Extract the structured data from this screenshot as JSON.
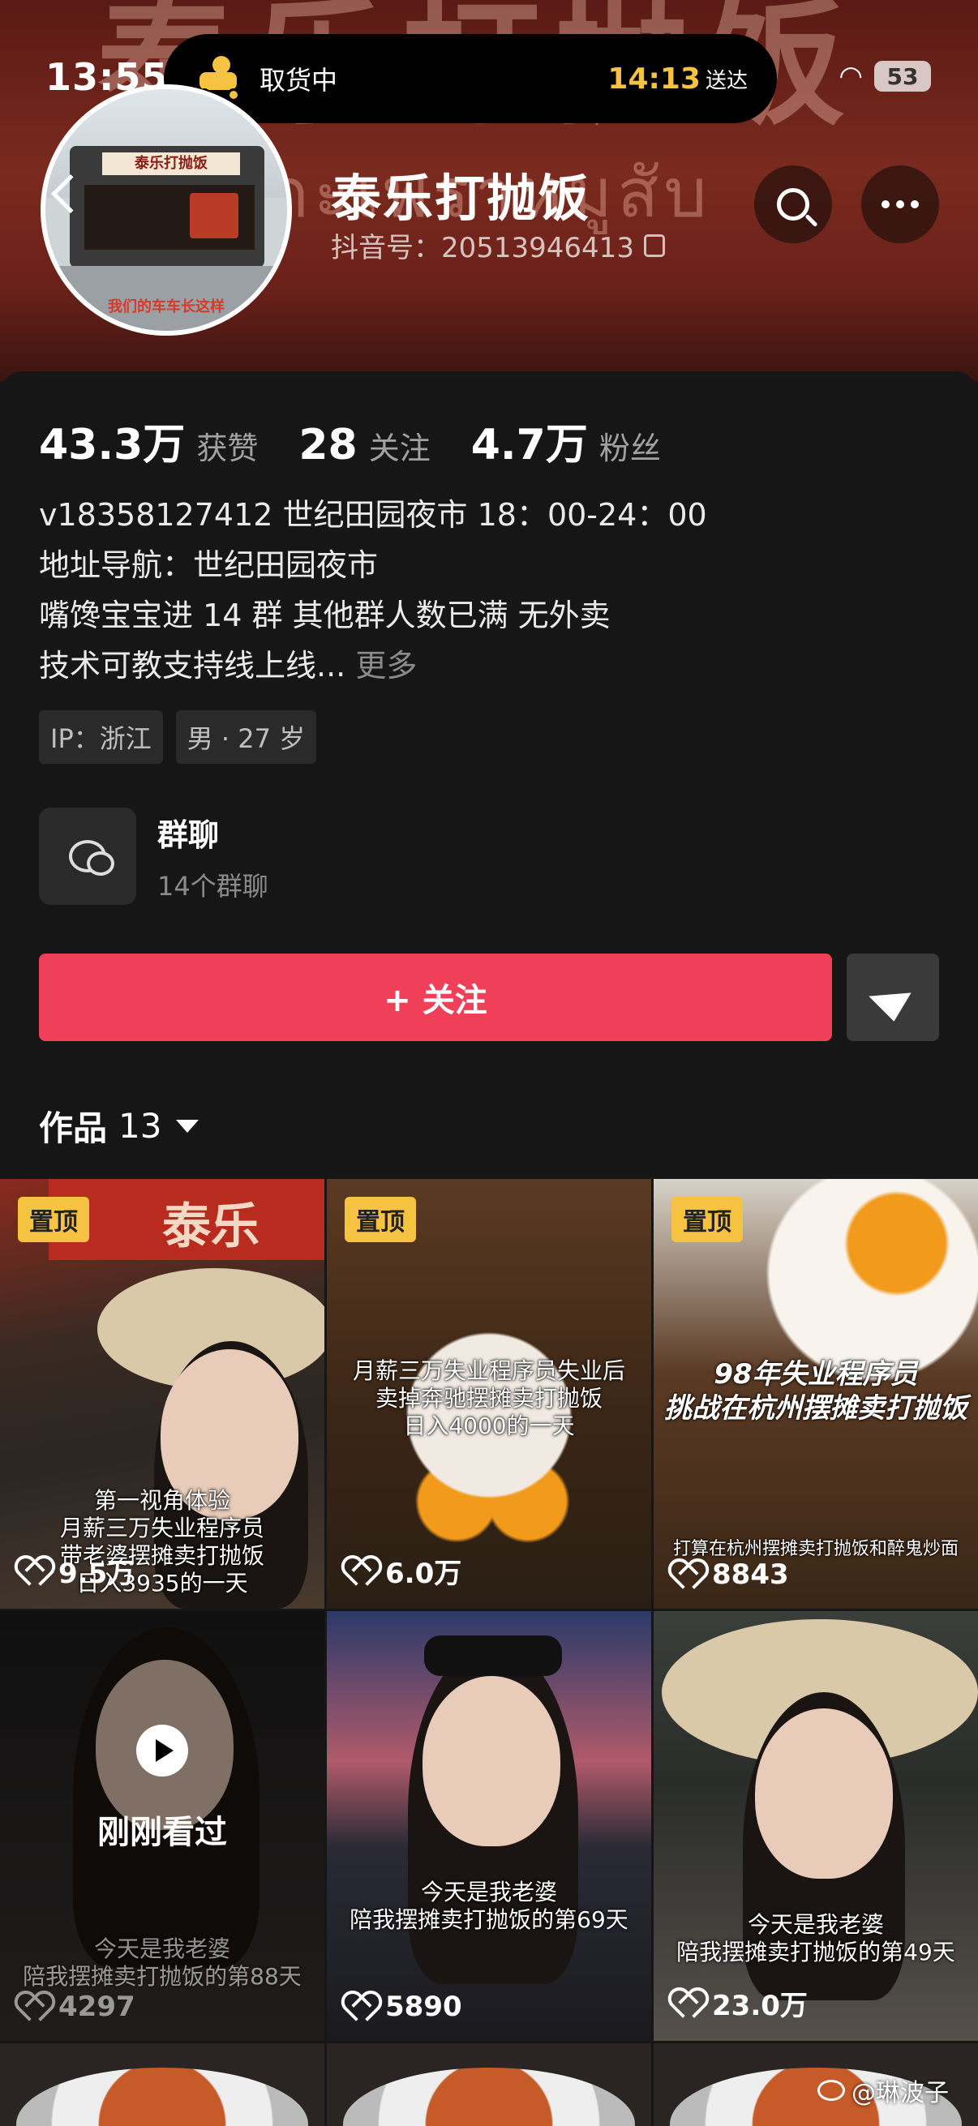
{
  "status": {
    "time": "13:55",
    "battery": "53"
  },
  "live_activity": {
    "label": "取货中",
    "eta_time": "14:13",
    "eta_label": "送达"
  },
  "profile": {
    "name": "泰乐打抛饭",
    "douyin_id": "抖音号：2051394641​3",
    "avatar_caption": "我们的车车长这样",
    "avatar_sign": "泰乐打抛饭",
    "banner_text": "泰乐打抛饭",
    "banner_thai": "กะเพราหมูสับ"
  },
  "stats": [
    {
      "num": "43.3万",
      "label": "获赞"
    },
    {
      "num": "28",
      "label": "关注"
    },
    {
      "num": "4.7万",
      "label": "粉丝"
    }
  ],
  "bio": {
    "line1": "v18358127412  世纪田园夜市 18：00-24：00",
    "line2": "地址导航：世纪田园夜市",
    "line3": "嘴馋宝宝进 14 群 其他群人数已满 无外卖",
    "line4": "技术可教支持线上线...",
    "more": "更多"
  },
  "tags": [
    "IP：浙江",
    "男 · 27 岁"
  ],
  "group": {
    "title": "群聊",
    "subtitle": "14个群聊"
  },
  "follow_label": "+ 关注",
  "works": {
    "label": "作品",
    "count": "13"
  },
  "videos": [
    {
      "pinned": "置顶",
      "likes": "9.5万",
      "caption": "第一视角体验\n月薪三万失业程序员\n带老婆摆摊卖打抛饭\n日入3935的一天",
      "sign": "泰乐"
    },
    {
      "pinned": "置顶",
      "likes": "6.0万",
      "caption": "月薪三万失业程序员失业后\n卖掉奔驰摆摊卖打抛饭\n日入4000的一天"
    },
    {
      "pinned": "置顶",
      "likes": "8843",
      "caption": "98年失业程序员\n挑战在杭州摆摊卖打抛饭",
      "caption2": "打算在杭州摆摊卖打抛饭和醉鬼炒面"
    },
    {
      "likes": "4297",
      "caption": "今天是我老婆\n陪我摆摊卖打抛饭的第88天",
      "watched": "刚刚看过"
    },
    {
      "likes": "5890",
      "caption": "今天是我老婆\n陪我摆摊卖打抛饭的第69天"
    },
    {
      "likes": "23.0万",
      "caption": "今天是我老婆\n陪我摆摊卖打抛饭的第49天"
    }
  ],
  "watermark": "@琳波子"
}
